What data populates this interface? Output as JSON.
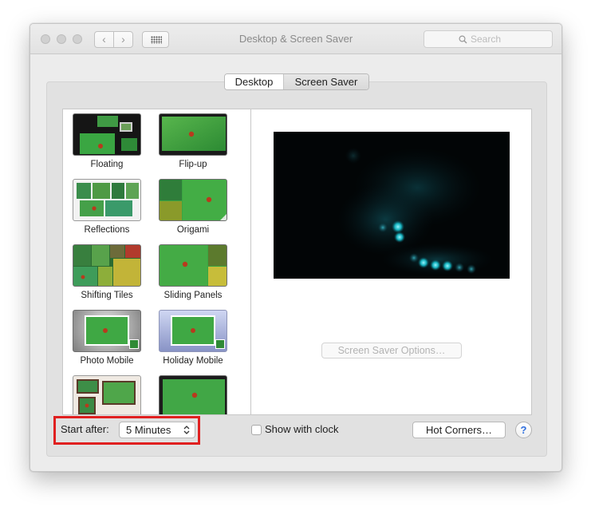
{
  "window": {
    "title": "Desktop & Screen Saver"
  },
  "toolbar": {
    "back_glyph": "‹",
    "forward_glyph": "›",
    "grid_icon": "grid-icon",
    "search_placeholder": "Search",
    "search_icon": "magnifier-icon"
  },
  "tabs": [
    {
      "label": "Desktop",
      "selected": false
    },
    {
      "label": "Screen Saver",
      "selected": true
    }
  ],
  "savers": [
    {
      "label": "Floating"
    },
    {
      "label": "Flip-up"
    },
    {
      "label": "Reflections"
    },
    {
      "label": "Origami"
    },
    {
      "label": "Shifting Tiles"
    },
    {
      "label": "Sliding Panels"
    },
    {
      "label": "Photo Mobile"
    },
    {
      "label": "Holiday Mobile"
    },
    {
      "label": ""
    },
    {
      "label": ""
    }
  ],
  "preview": {
    "options_button": "Screen Saver Options…"
  },
  "bottom": {
    "start_after_label": "Start after:",
    "start_after_value": "5 Minutes",
    "show_clock_label": "Show with clock",
    "show_clock_checked": false,
    "hot_corners_button": "Hot Corners…",
    "help_glyph": "?"
  },
  "colors": {
    "highlight": "#e02020",
    "preview_glow": "#19d8e6",
    "thumb_green": "#3aa642"
  }
}
